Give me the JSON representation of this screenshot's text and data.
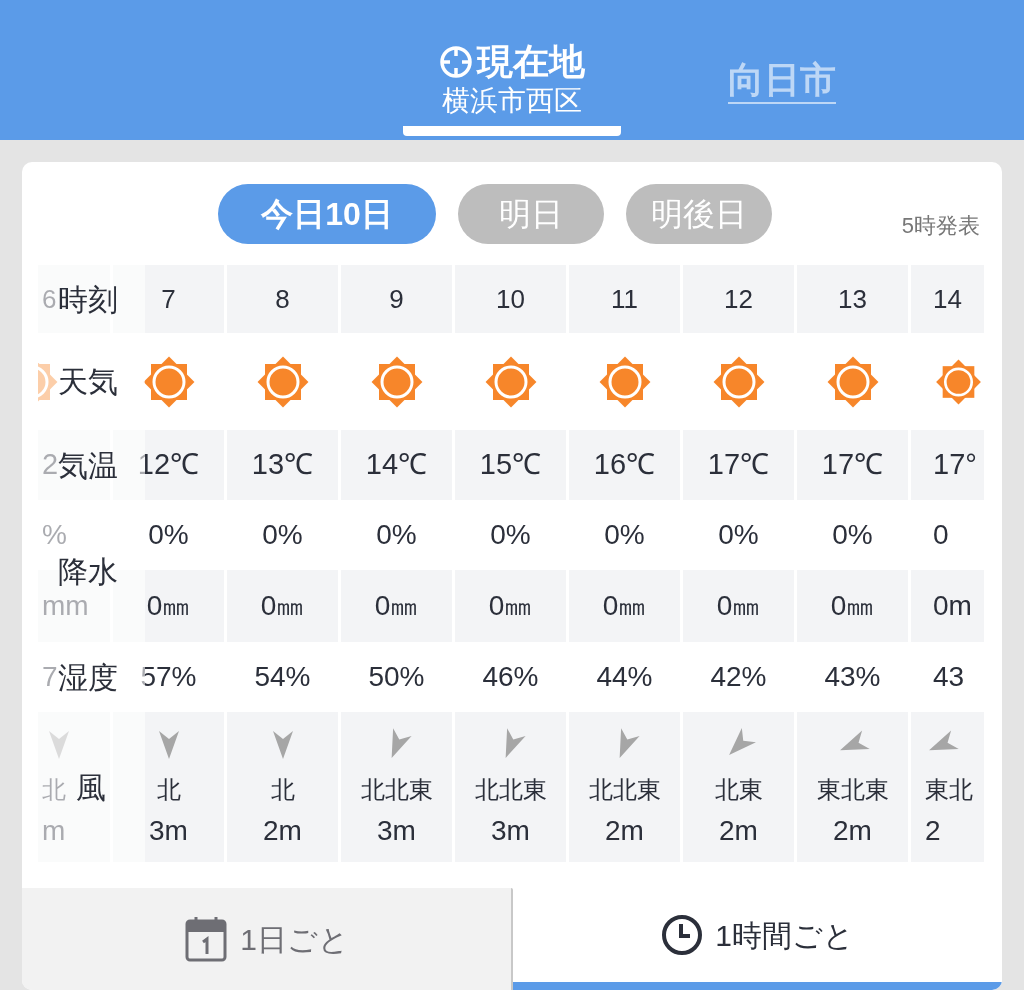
{
  "locations": [
    {
      "kind": "current",
      "title": "現在地",
      "subtitle": "横浜市西区",
      "selected": true
    },
    {
      "kind": "city",
      "title": "向日市",
      "selected": false
    }
  ],
  "days": [
    {
      "label": "今日10日",
      "selected": true
    },
    {
      "label": "明日",
      "selected": false
    },
    {
      "label": "明後日",
      "selected": false
    }
  ],
  "issued": "5時発表",
  "row_labels": {
    "time": "時刻",
    "weather": "天気",
    "temp": "気温",
    "precip": "降水",
    "humidity": "湿度",
    "wind": "風"
  },
  "hours": [
    {
      "kind": "cut_start",
      "hour": "6",
      "temp": "2",
      "precip": "%",
      "amount": "mm",
      "humidity": "7",
      "wind": {
        "kind": "toward_s",
        "direction": "北",
        "speed": "m"
      }
    },
    {
      "kind": "full",
      "hour": "7",
      "temp": "12℃",
      "precip": "0%",
      "amount": "0㎜",
      "humidity": "57%",
      "wind": {
        "kind": "toward_s",
        "direction": "北",
        "speed": "3m"
      }
    },
    {
      "kind": "full",
      "hour": "8",
      "temp": "13℃",
      "precip": "0%",
      "amount": "0㎜",
      "humidity": "54%",
      "wind": {
        "kind": "toward_s",
        "direction": "北",
        "speed": "2m"
      }
    },
    {
      "kind": "full",
      "hour": "9",
      "temp": "14℃",
      "precip": "0%",
      "amount": "0㎜",
      "humidity": "50%",
      "wind": {
        "kind": "toward_ssw",
        "direction": "北北東",
        "speed": "3m"
      }
    },
    {
      "kind": "full",
      "hour": "10",
      "temp": "15℃",
      "precip": "0%",
      "amount": "0㎜",
      "humidity": "46%",
      "wind": {
        "kind": "toward_ssw",
        "direction": "北北東",
        "speed": "3m"
      }
    },
    {
      "kind": "full",
      "hour": "11",
      "temp": "16℃",
      "precip": "0%",
      "amount": "0㎜",
      "humidity": "44%",
      "wind": {
        "kind": "toward_ssw",
        "direction": "北北東",
        "speed": "2m"
      }
    },
    {
      "kind": "full",
      "hour": "12",
      "temp": "17℃",
      "precip": "0%",
      "amount": "0㎜",
      "humidity": "42%",
      "wind": {
        "kind": "toward_sw",
        "direction": "北東",
        "speed": "2m"
      }
    },
    {
      "kind": "full",
      "hour": "13",
      "temp": "17℃",
      "precip": "0%",
      "amount": "0㎜",
      "humidity": "43%",
      "wind": {
        "kind": "toward_wsw",
        "direction": "東北東",
        "speed": "2m"
      }
    },
    {
      "kind": "cut_end",
      "hour": "14",
      "temp": "17°",
      "precip": "0",
      "amount": "0m",
      "humidity": "43",
      "wind": {
        "kind": "toward_wsw",
        "direction": "東北",
        "speed": "2"
      }
    }
  ],
  "view_tabs": [
    {
      "label": "1日ごと",
      "selected": false
    },
    {
      "label": "1時間ごと",
      "selected": true
    }
  ]
}
